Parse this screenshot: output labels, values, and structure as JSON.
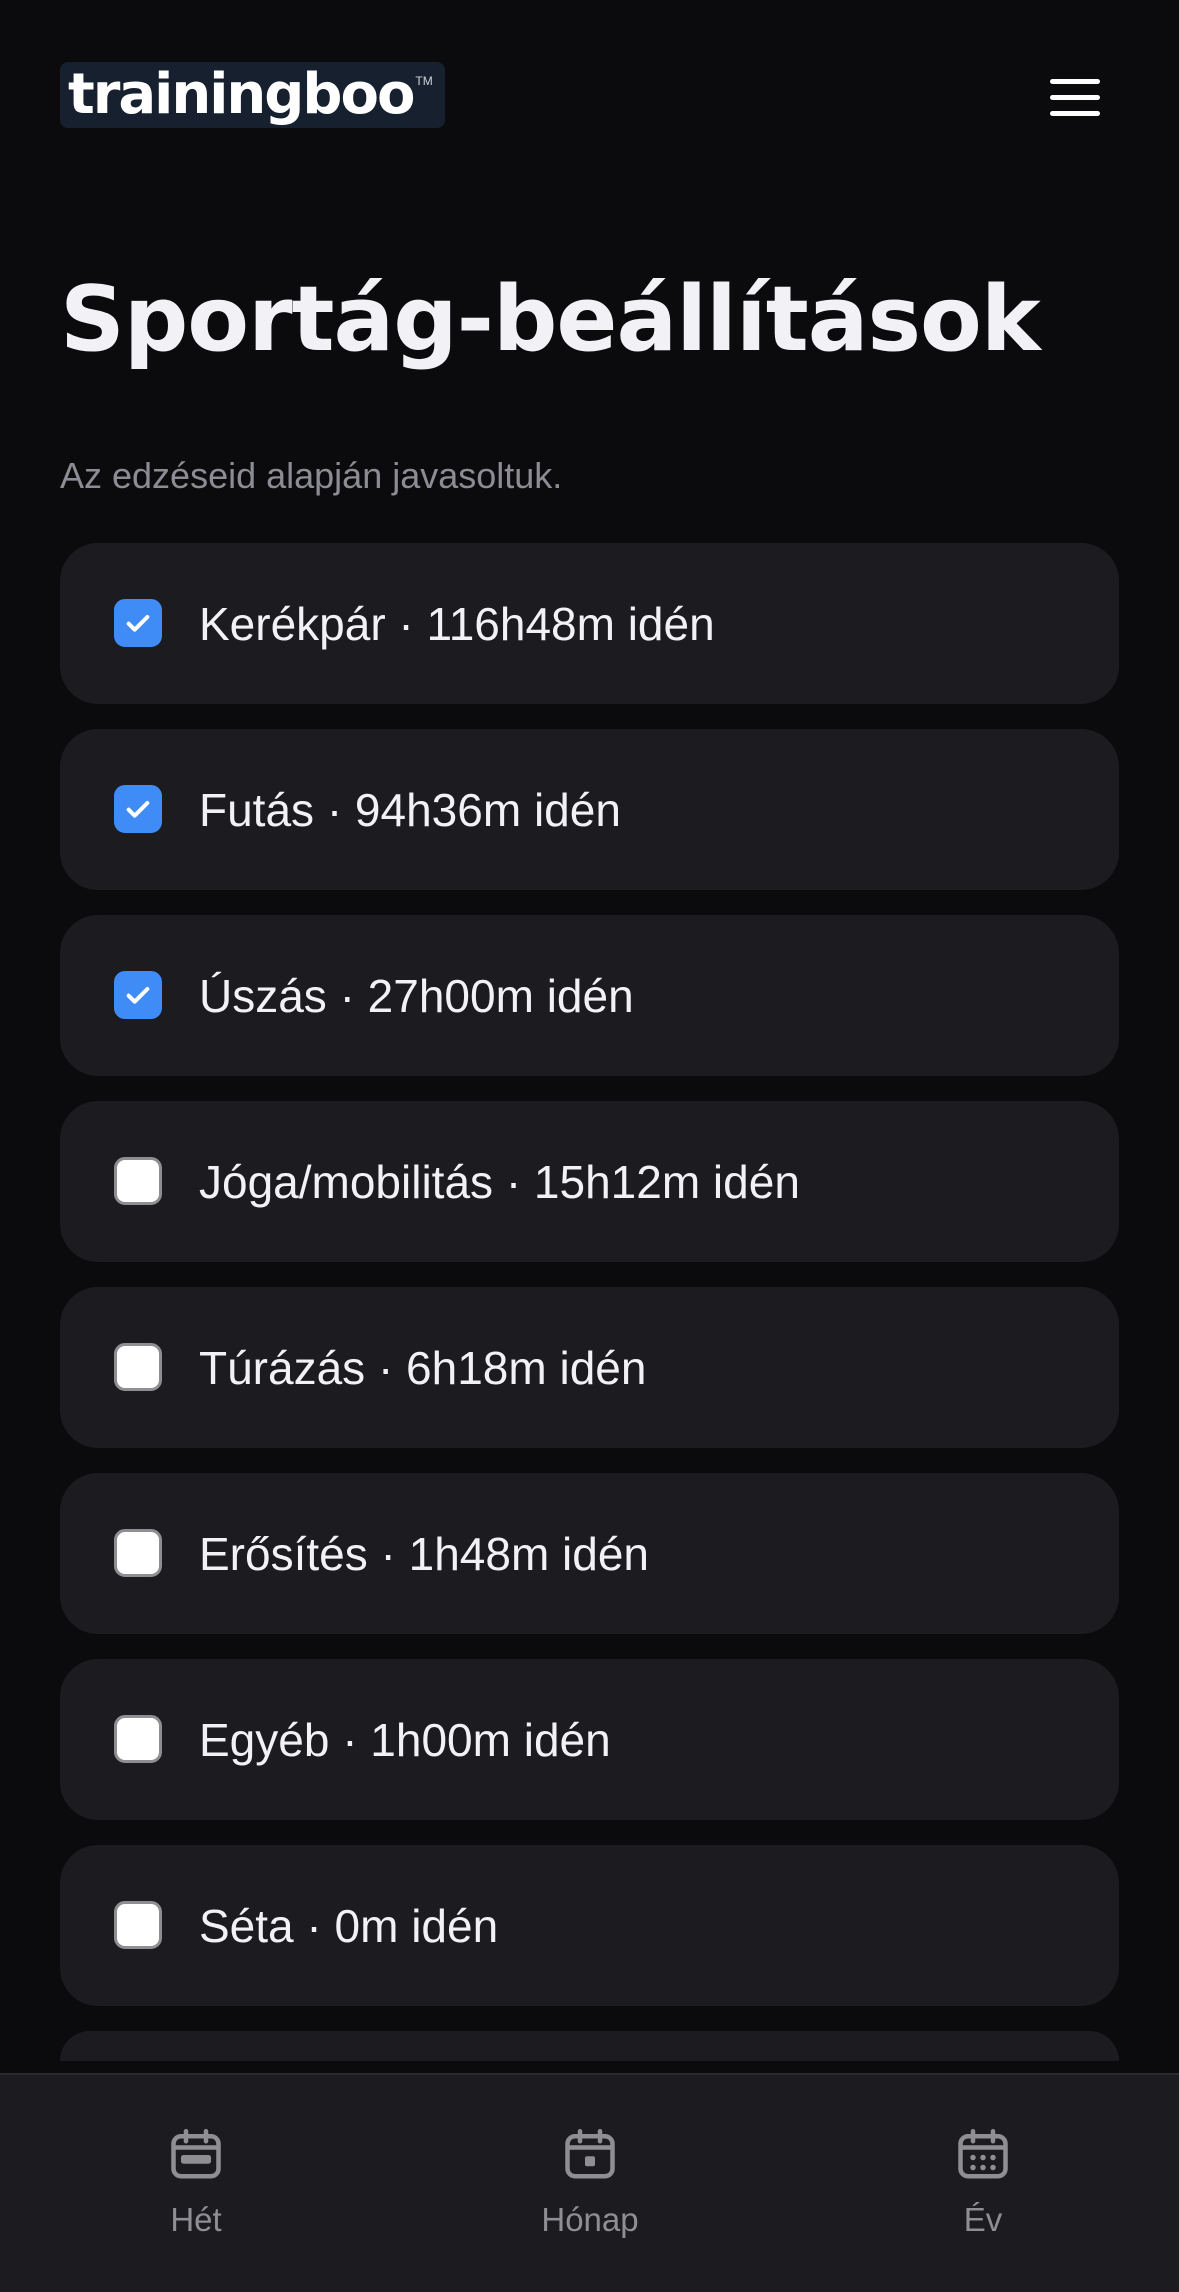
{
  "header": {
    "logo_text": "trainingboo",
    "logo_tm": "TM",
    "menu_icon": "hamburger-menu-icon"
  },
  "page": {
    "title": "Sportág-beállítások",
    "subtitle": "Az edzéseid alapján javasoltuk."
  },
  "sports": [
    {
      "label": "Kerékpár · 116h48m idén",
      "checked": true
    },
    {
      "label": "Futás · 94h36m idén",
      "checked": true
    },
    {
      "label": "Úszás · 27h00m idén",
      "checked": true
    },
    {
      "label": "Jóga/mobilitás · 15h12m idén",
      "checked": false
    },
    {
      "label": "Túrázás · 6h18m idén",
      "checked": false
    },
    {
      "label": "Erősítés · 1h48m idén",
      "checked": false
    },
    {
      "label": "Egyéb · 1h00m idén",
      "checked": false
    },
    {
      "label": "Séta · 0m idén",
      "checked": false
    }
  ],
  "bottom_nav": {
    "items": [
      {
        "label": "Hét",
        "icon": "calendar-week-icon"
      },
      {
        "label": "Hónap",
        "icon": "calendar-day-icon"
      },
      {
        "label": "Év",
        "icon": "calendar-grid-icon"
      }
    ]
  },
  "colors": {
    "background": "#0b0b0e",
    "card": "#1b1b20",
    "accent": "#3f8cf7",
    "muted_text": "#8c8c94"
  }
}
